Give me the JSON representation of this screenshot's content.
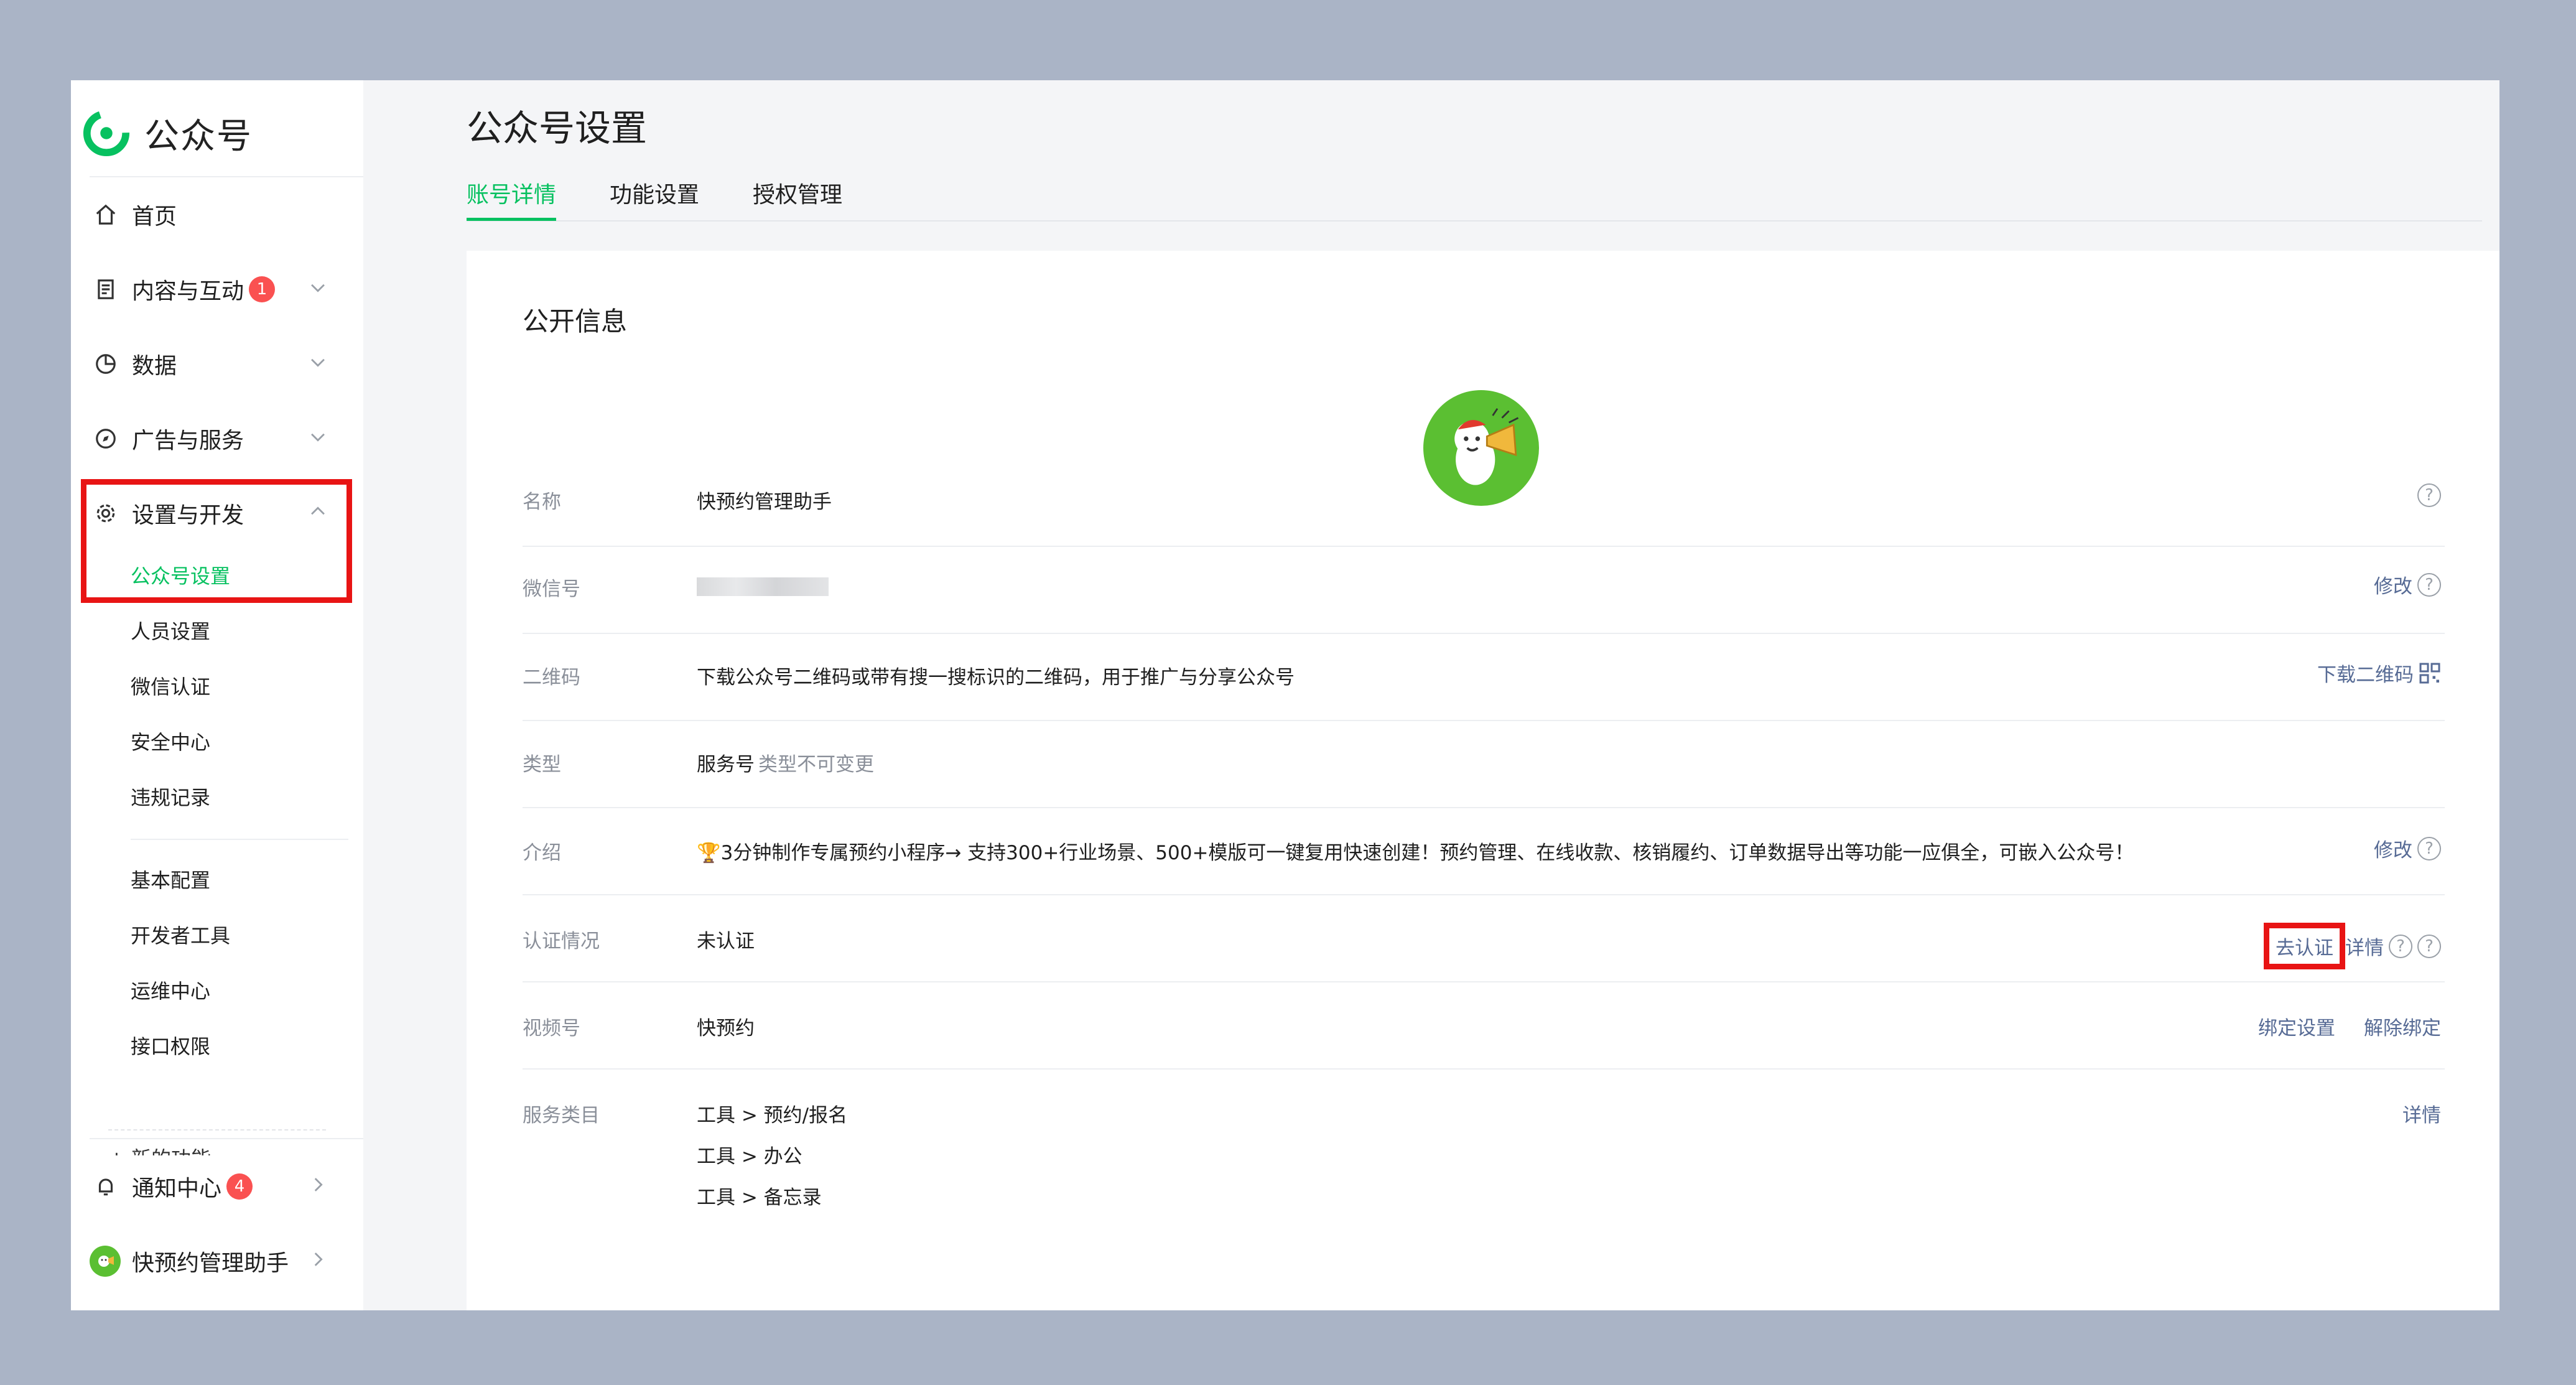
{
  "app": {
    "logo_text": "公众号"
  },
  "sidebar": {
    "home": "首页",
    "content": "内容与互动",
    "content_badge": "1",
    "data": "数据",
    "ads": "广告与服务",
    "settings": "设置与开发",
    "sub_items": [
      "公众号设置",
      "人员设置",
      "微信认证",
      "安全中心",
      "违规记录"
    ],
    "dev_items": [
      "基本配置",
      "开发者工具",
      "运维中心",
      "接口权限"
    ],
    "new_func": "新的功能",
    "notify": "通知中心",
    "notify_badge": "4",
    "account": "快预约管理助手"
  },
  "main": {
    "title": "公众号设置",
    "tabs": [
      "账号详情",
      "功能设置",
      "授权管理"
    ],
    "section_title": "公开信息",
    "rows": {
      "name": {
        "label": "名称",
        "value": "快预约管理助手"
      },
      "wechat_id": {
        "label": "微信号",
        "action": "修改"
      },
      "qrcode": {
        "label": "二维码",
        "value": "下载公众号二维码或带有搜一搜标识的二维码，用于推广与分享公众号",
        "action": "下载二维码"
      },
      "type": {
        "label": "类型",
        "value": "服务号",
        "note": "类型不可变更"
      },
      "intro": {
        "label": "介绍",
        "value": "🏆3分钟制作专属预约小程序→ 支持300+行业场景、500+模版可一键复用快速创建！预约管理、在线收款、核销履约、订单数据导出等功能一应俱全，可嵌入公众号！",
        "action": "修改"
      },
      "verify": {
        "label": "认证情况",
        "value": "未认证",
        "action_go": "去认证",
        "action_detail": "详情"
      },
      "channels": {
        "label": "视频号",
        "value": "快预约",
        "action_bind": "绑定设置",
        "action_unbind": "解除绑定"
      },
      "category": {
        "label": "服务类目",
        "lines": [
          "工具 > 预约/报名",
          "工具 > 办公",
          "工具 > 备忘录"
        ],
        "action": "详情"
      }
    }
  },
  "colors": {
    "accent": "#07c160",
    "link": "#576b95",
    "highlight": "#e81414",
    "badge": "#fa5151"
  }
}
